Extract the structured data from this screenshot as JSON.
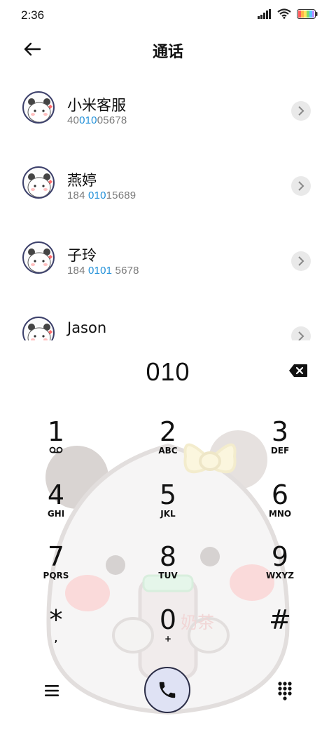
{
  "status": {
    "time": "2:36"
  },
  "header": {
    "title": "通话"
  },
  "contacts": [
    {
      "name": "小米客服",
      "number_parts": [
        "40",
        "010",
        "05678"
      ]
    },
    {
      "name": "燕婷",
      "number_parts": [
        "184 ",
        "010",
        "15689"
      ]
    },
    {
      "name": "子玲",
      "number_parts": [
        "184 ",
        "0101",
        " 5678"
      ]
    },
    {
      "name": "Jason",
      "number_parts": [
        "",
        "",
        ""
      ]
    }
  ],
  "dialer": {
    "input": "010",
    "keys": [
      {
        "digit": "1",
        "letters": ""
      },
      {
        "digit": "2",
        "letters": "ABC"
      },
      {
        "digit": "3",
        "letters": "DEF"
      },
      {
        "digit": "4",
        "letters": "GHI"
      },
      {
        "digit": "5",
        "letters": "JKL"
      },
      {
        "digit": "6",
        "letters": "MNO"
      },
      {
        "digit": "7",
        "letters": "PQRS"
      },
      {
        "digit": "8",
        "letters": "TUV"
      },
      {
        "digit": "9",
        "letters": "WXYZ"
      },
      {
        "digit": "*",
        "letters": ","
      },
      {
        "digit": "0",
        "letters": "+"
      },
      {
        "digit": "#",
        "letters": ""
      }
    ],
    "watermark_text": "奶茶"
  },
  "colors": {
    "highlight": "#1f8fd8",
    "call_button": "#dfe2f4"
  }
}
